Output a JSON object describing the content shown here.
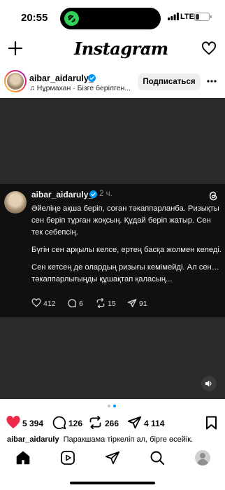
{
  "status_bar": {
    "time": "20:55",
    "network": "LTE",
    "battery": "30",
    "battery_level": 0.3,
    "activity_color": "#2fd158"
  },
  "header": {
    "app_name": "Instagram",
    "left_icon": "plus-icon",
    "right_icon": "heart-icon"
  },
  "post": {
    "username": "aibar_aidaruly_",
    "verified": true,
    "music": "Нұрмахан · Бізге берілген...",
    "follow_label": "Подписаться",
    "more_icon": "more-horizontal-icon",
    "thread": {
      "username": "aibar_aidaruly_",
      "time_ago": "2 ч.",
      "paragraphs": [
        "Әйеліңе ақша беріп, соған тәкаппарланба. Ризықты сен беріп тұрған жоқсың. Құдай беріп жатыр. Сен тек себепсің.",
        "Бүгін сен арқылы келсе, ертең басқа жолмен келеді.",
        "Сен кетсең де олардың ризығы кемімейді. Ал сен… тәкаппарлығыңды құшақтап қаласың..."
      ],
      "likes": "412",
      "comments": "6",
      "reposts": "15",
      "shares": "91"
    },
    "carousel": {
      "count": 2,
      "active_index": 1
    },
    "actions": {
      "likes": "5 394",
      "comments": "126",
      "reposts": "266",
      "shares": "4 114"
    },
    "caption": {
      "username": "aibar_aidaruly",
      "text": "Паракшама тіркеліп ал, бірге өсейік."
    }
  },
  "tabs": [
    "home-icon",
    "reels-icon",
    "send-icon",
    "search-icon",
    "profile-avatar"
  ],
  "colors": {
    "like": "#ed2a4a",
    "verified": "#0095f6",
    "media_bg": "#2a2a2a",
    "card_bg": "#101010",
    "carousel_active": "#0095f6",
    "carousel_inactive": "#c7c7c7"
  }
}
